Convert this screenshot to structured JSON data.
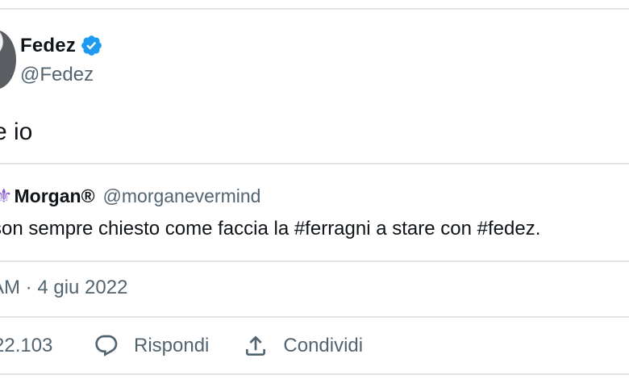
{
  "author": {
    "name": "Fedez",
    "handle": "@Fedez",
    "verified": true,
    "verified_color": "#1d9bf0"
  },
  "tweet": {
    "text": "e io"
  },
  "quoted": {
    "emoji": "⚜",
    "name": "Morgan®",
    "handle": "@morganevermind",
    "text": "son sempre chiesto come faccia la #ferragni a stare con #fedez."
  },
  "meta": {
    "timestamp": "AM · 4 giu 2022"
  },
  "actions": {
    "count": "22.103",
    "reply_label": "Rispondi",
    "share_label": "Condividi"
  },
  "colors": {
    "text": "#0f1419",
    "secondary": "#536471",
    "divider": "#dfe3e6"
  }
}
